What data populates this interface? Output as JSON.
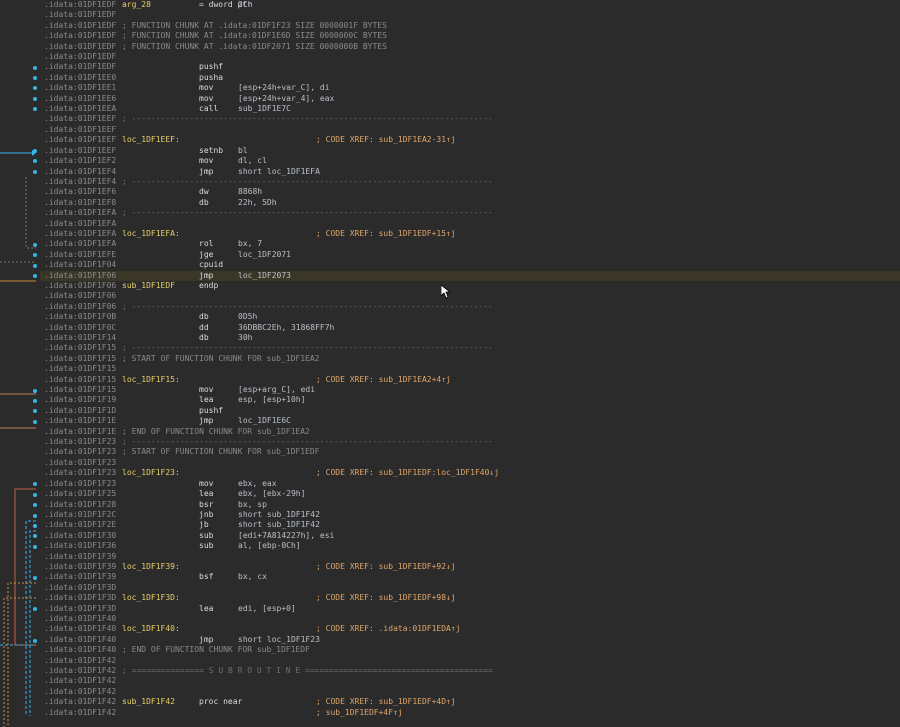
{
  "lines": [
    {
      "a": ".idata:01DF1EDF",
      "l": "arg_28",
      "m": "= dword ptr",
      "o": "2Ch"
    },
    {
      "a": ".idata:01DF1EDF"
    },
    {
      "a": ".idata:01DF1EDF",
      "t": "; FUNCTION CHUNK AT .idata:01DF1F23 SIZE 0000001F BYTES"
    },
    {
      "a": ".idata:01DF1EDF",
      "t": "; FUNCTION CHUNK AT .idata:01DF1E6D SIZE 0000000C BYTES"
    },
    {
      "a": ".idata:01DF1EDF",
      "t": "; FUNCTION CHUNK AT .idata:01DF2071 SIZE 0000000B BYTES"
    },
    {
      "a": ".idata:01DF1EDF"
    },
    {
      "a": ".idata:01DF1EDF",
      "m": "pushf"
    },
    {
      "a": ".idata:01DF1EE0",
      "m": "pusha"
    },
    {
      "a": ".idata:01DF1EE1",
      "m": "mov",
      "o": "[esp+24h+var_C], di"
    },
    {
      "a": ".idata:01DF1EE6",
      "m": "mov",
      "o": "[esp+24h+var_4], eax"
    },
    {
      "a": ".idata:01DF1EEA",
      "m": "call",
      "o": "sub_1DF1E7C"
    },
    {
      "a": ".idata:01DF1EEF",
      "t": "; ---------------------------------------------------------------------------"
    },
    {
      "a": ".idata:01DF1EEF"
    },
    {
      "a": ".idata:01DF1EEF",
      "l": "loc_1DF1EEF:",
      "c": "; CODE XREF: sub_1DF1EA2-31↑j"
    },
    {
      "a": ".idata:01DF1EEF",
      "m": "setnb",
      "o": "bl"
    },
    {
      "a": ".idata:01DF1EF2",
      "m": "mov",
      "o": "dl, cl"
    },
    {
      "a": ".idata:01DF1EF4",
      "m": "jmp",
      "o": "short loc_1DF1EFA"
    },
    {
      "a": ".idata:01DF1EF4",
      "t": "; ---------------------------------------------------------------------------"
    },
    {
      "a": ".idata:01DF1EF6",
      "m": "dw",
      "o": "8868h"
    },
    {
      "a": ".idata:01DF1EF8",
      "m": "db",
      "o": "22h, 5Dh"
    },
    {
      "a": ".idata:01DF1EFA",
      "t": "; ---------------------------------------------------------------------------"
    },
    {
      "a": ".idata:01DF1EFA"
    },
    {
      "a": ".idata:01DF1EFA",
      "l": "loc_1DF1EFA:",
      "c": "; CODE XREF: sub_1DF1EDF+15↑j"
    },
    {
      "a": ".idata:01DF1EFA",
      "m": "rol",
      "o": "bx, 7"
    },
    {
      "a": ".idata:01DF1EFE",
      "m": "jge",
      "o": "loc_1DF2071"
    },
    {
      "a": ".idata:01DF1F04",
      "m": "cpuid"
    },
    {
      "a": ".idata:01DF1F06",
      "m": "jmp",
      "o": "loc_1DF2073",
      "hl": true
    },
    {
      "a": ".idata:01DF1F06",
      "l": "sub_1DF1EDF",
      "m": "endp"
    },
    {
      "a": ".idata:01DF1F06"
    },
    {
      "a": ".idata:01DF1F06",
      "t": "; ---------------------------------------------------------------------------"
    },
    {
      "a": ".idata:01DF1F0B",
      "m": "db",
      "o": "0D5h"
    },
    {
      "a": ".idata:01DF1F0C",
      "m": "dd",
      "o": "36DBBC2Eh, 31868FF7h"
    },
    {
      "a": ".idata:01DF1F14",
      "m": "db",
      "o": "30h"
    },
    {
      "a": ".idata:01DF1F15",
      "t": "; ---------------------------------------------------------------------------"
    },
    {
      "a": ".idata:01DF1F15",
      "t": "; START OF FUNCTION CHUNK FOR sub_1DF1EA2"
    },
    {
      "a": ".idata:01DF1F15"
    },
    {
      "a": ".idata:01DF1F15",
      "l": "loc_1DF1F15:",
      "c": "; CODE XREF: sub_1DF1EA2+4↑j"
    },
    {
      "a": ".idata:01DF1F15",
      "m": "mov",
      "o": "[esp+arg_C], edi"
    },
    {
      "a": ".idata:01DF1F19",
      "m": "lea",
      "o": "esp, [esp+10h]"
    },
    {
      "a": ".idata:01DF1F1D",
      "m": "pushf"
    },
    {
      "a": ".idata:01DF1F1E",
      "m": "jmp",
      "o": "loc_1DF1E6C"
    },
    {
      "a": ".idata:01DF1F1E",
      "t": "; END OF FUNCTION CHUNK FOR sub_1DF1EA2"
    },
    {
      "a": ".idata:01DF1F23",
      "t": "; ---------------------------------------------------------------------------"
    },
    {
      "a": ".idata:01DF1F23",
      "t": "; START OF FUNCTION CHUNK FOR sub_1DF1EDF"
    },
    {
      "a": ".idata:01DF1F23"
    },
    {
      "a": ".idata:01DF1F23",
      "l": "loc_1DF1F23:",
      "c": "; CODE XREF: sub_1DF1EDF:loc_1DF1F40↓j"
    },
    {
      "a": ".idata:01DF1F23",
      "m": "mov",
      "o": "ebx, eax"
    },
    {
      "a": ".idata:01DF1F25",
      "m": "lea",
      "o": "ebx, [ebx-29h]"
    },
    {
      "a": ".idata:01DF1F28",
      "m": "bsr",
      "o": "bx, sp"
    },
    {
      "a": ".idata:01DF1F2C",
      "m": "jnb",
      "o": "short sub_1DF1F42"
    },
    {
      "a": ".idata:01DF1F2E",
      "m": "jb",
      "o": "short sub_1DF1F42"
    },
    {
      "a": ".idata:01DF1F30",
      "m": "sub",
      "o": "[edi+7A814227h], esi"
    },
    {
      "a": ".idata:01DF1F36",
      "m": "sub",
      "o": "al, [ebp-0Ch]"
    },
    {
      "a": ".idata:01DF1F39"
    },
    {
      "a": ".idata:01DF1F39",
      "l": "loc_1DF1F39:",
      "c": "; CODE XREF: sub_1DF1EDF+92↓j"
    },
    {
      "a": ".idata:01DF1F39",
      "m": "bsf",
      "o": "bx, cx"
    },
    {
      "a": ".idata:01DF1F3D"
    },
    {
      "a": ".idata:01DF1F3D",
      "l": "loc_1DF1F3D:",
      "c": "; CODE XREF: sub_1DF1EDF+98↓j"
    },
    {
      "a": ".idata:01DF1F3D",
      "m": "lea",
      "o": "edi, [esp+0]"
    },
    {
      "a": ".idata:01DF1F40"
    },
    {
      "a": ".idata:01DF1F40",
      "l": "loc_1DF1F40:",
      "c": "; CODE XREF: .idata:01DF1EDA↑j"
    },
    {
      "a": ".idata:01DF1F40",
      "m": "jmp",
      "o": "short loc_1DF1F23"
    },
    {
      "a": ".idata:01DF1F40",
      "t": "; END OF FUNCTION CHUNK FOR sub_1DF1EDF"
    },
    {
      "a": ".idata:01DF1F42"
    },
    {
      "a": ".idata:01DF1F42",
      "t": "; =============== S U B R O U T I N E ======================================="
    },
    {
      "a": ".idata:01DF1F42"
    },
    {
      "a": ".idata:01DF1F42"
    },
    {
      "a": ".idata:01DF1F42",
      "l": "sub_1DF1F42",
      "m": "proc near",
      "c": "; CODE XREF: sub_1DF1EDF+4D↑j"
    },
    {
      "a": ".idata:01DF1F42",
      "c": "; sub_1DF1EDF+4F↑j"
    }
  ]
}
